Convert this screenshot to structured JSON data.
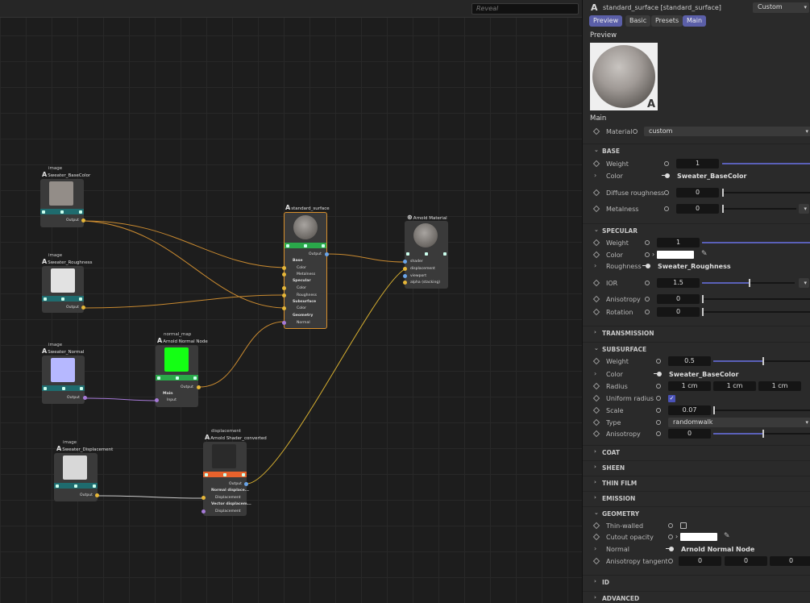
{
  "canvas": {
    "search_placeholder": "Reveal",
    "nodes": {
      "basecolor": {
        "category": "image",
        "title": "Sweater_BaseColor",
        "out": "Output"
      },
      "roughness": {
        "category": "image",
        "title": "Sweater_Roughness",
        "out": "Output"
      },
      "normal": {
        "category": "image",
        "title": "Sweater_Normal",
        "out": "Output"
      },
      "displacement_img": {
        "category": "image",
        "title": "Sweater_Displacement",
        "out": "Output"
      },
      "normalmap": {
        "category": "normal_map",
        "title": "Arnold Normal Node",
        "main": "Main",
        "input": "Input",
        "out": "Output"
      },
      "standard": {
        "title": "standard_surface",
        "out": "Output",
        "ports": [
          "Base",
          "Color",
          "Metalness",
          "Specular",
          "Color",
          "Roughness",
          "Subsurface",
          "Color",
          "Geometry",
          "Normal"
        ]
      },
      "material": {
        "title": "Arnold Material",
        "ports": [
          "shader",
          "displacement",
          "viewport",
          "alpha (stacking)"
        ]
      },
      "disp": {
        "category": "displacement",
        "title": "Arnold Shader_converted",
        "out": "Output",
        "ports": [
          "Normal displace...",
          "Displacement",
          "Vector displacem...",
          "Displacement"
        ]
      }
    }
  },
  "panel": {
    "header": {
      "title": "standard_surface [standard_surface]",
      "preset_value": "Custom"
    },
    "tabs": [
      "Preview",
      "Basic",
      "Presets",
      "Main"
    ],
    "preview_label": "Preview",
    "main_label": "Main",
    "material": {
      "label": "Material",
      "value": "custom"
    },
    "base": {
      "title": "BASE",
      "weight_label": "Weight",
      "weight": "1",
      "weight_frac": 1.0,
      "color_label": "Color",
      "color_value": "Sweater_BaseColor",
      "diffuse_label": "Diffuse roughness",
      "diffuse": "0",
      "metal_label": "Metalness",
      "metal": "0"
    },
    "specular": {
      "title": "SPECULAR",
      "weight_label": "Weight",
      "weight": "1",
      "weight_frac": 1.0,
      "color_label": "Color",
      "rough_label": "Roughness",
      "rough_value": "Sweater_Roughness",
      "ior_label": "IOR",
      "ior": "1.5",
      "ior_frac": 0.5,
      "aniso_label": "Anisotropy",
      "aniso": "0",
      "rot_label": "Rotation",
      "rot": "0"
    },
    "transmission": "TRANSMISSION",
    "subsurface": {
      "title": "SUBSURFACE",
      "weight_label": "Weight",
      "weight": "0.5",
      "weight_frac": 0.5,
      "color_label": "Color",
      "color_value": "Sweater_BaseColor",
      "radius_label": "Radius",
      "r1": "1 cm",
      "r2": "1 cm",
      "r3": "1 cm",
      "uniform_label": "Uniform radius",
      "scale_label": "Scale",
      "scale": "0.07",
      "type_label": "Type",
      "type_value": "randomwalk",
      "aniso_label": "Anisotropy",
      "aniso": "0",
      "aniso_frac": 0.5
    },
    "coat": "COAT",
    "sheen": "SHEEN",
    "thinfilm": "THIN FILM",
    "emission": "EMISSION",
    "geometry": {
      "title": "GEOMETRY",
      "thin_label": "Thin-walled",
      "cut_label": "Cutout opacity",
      "normal_label": "Normal",
      "normal_value": "Arnold Normal Node",
      "tangent_label": "Anisotropy tangent",
      "t1": "0",
      "t2": "0",
      "t3": "0"
    },
    "id": "ID",
    "advanced": "ADVANCED"
  }
}
